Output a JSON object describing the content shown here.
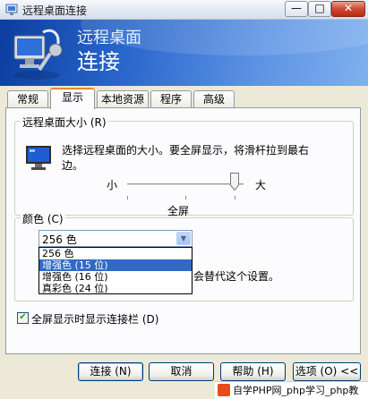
{
  "window": {
    "title": "远程桌面连接",
    "min_glyph": "—",
    "max_glyph": "□",
    "close_glyph": "✕"
  },
  "banner": {
    "line1": "远程桌面",
    "line2": "连接"
  },
  "tabs": [
    {
      "label": "常规",
      "active": false
    },
    {
      "label": "显示",
      "active": true
    },
    {
      "label": "本地资源",
      "active": false
    },
    {
      "label": "程序",
      "active": false
    },
    {
      "label": "高级",
      "active": false
    }
  ],
  "size_group": {
    "title": "远程桌面大小 (R)",
    "description": "选择远程桌面的大小。要全屏显示，将滑杆拉到最右边。",
    "slider_left": "小",
    "slider_right": "大",
    "slider_value_label": "全屏",
    "slider_level": 1.0
  },
  "color_group": {
    "title": "颜色 (C)",
    "selected": "256 色",
    "options": [
      "256 色",
      "增强色 (15 位)",
      "增强色 (16 位)",
      "真彩色 (24 位)"
    ],
    "highlighted_index": 1,
    "note": "会替代这个设置。"
  },
  "checkbox": {
    "label": "全屏显示时显示连接栏 (D)",
    "checked": true
  },
  "buttons": {
    "connect": "连接 (N)",
    "cancel": "取消",
    "help": "帮助 (H)",
    "options": "选项 (O) <<"
  },
  "watermark": "自学PHP网_php学习_php教"
}
